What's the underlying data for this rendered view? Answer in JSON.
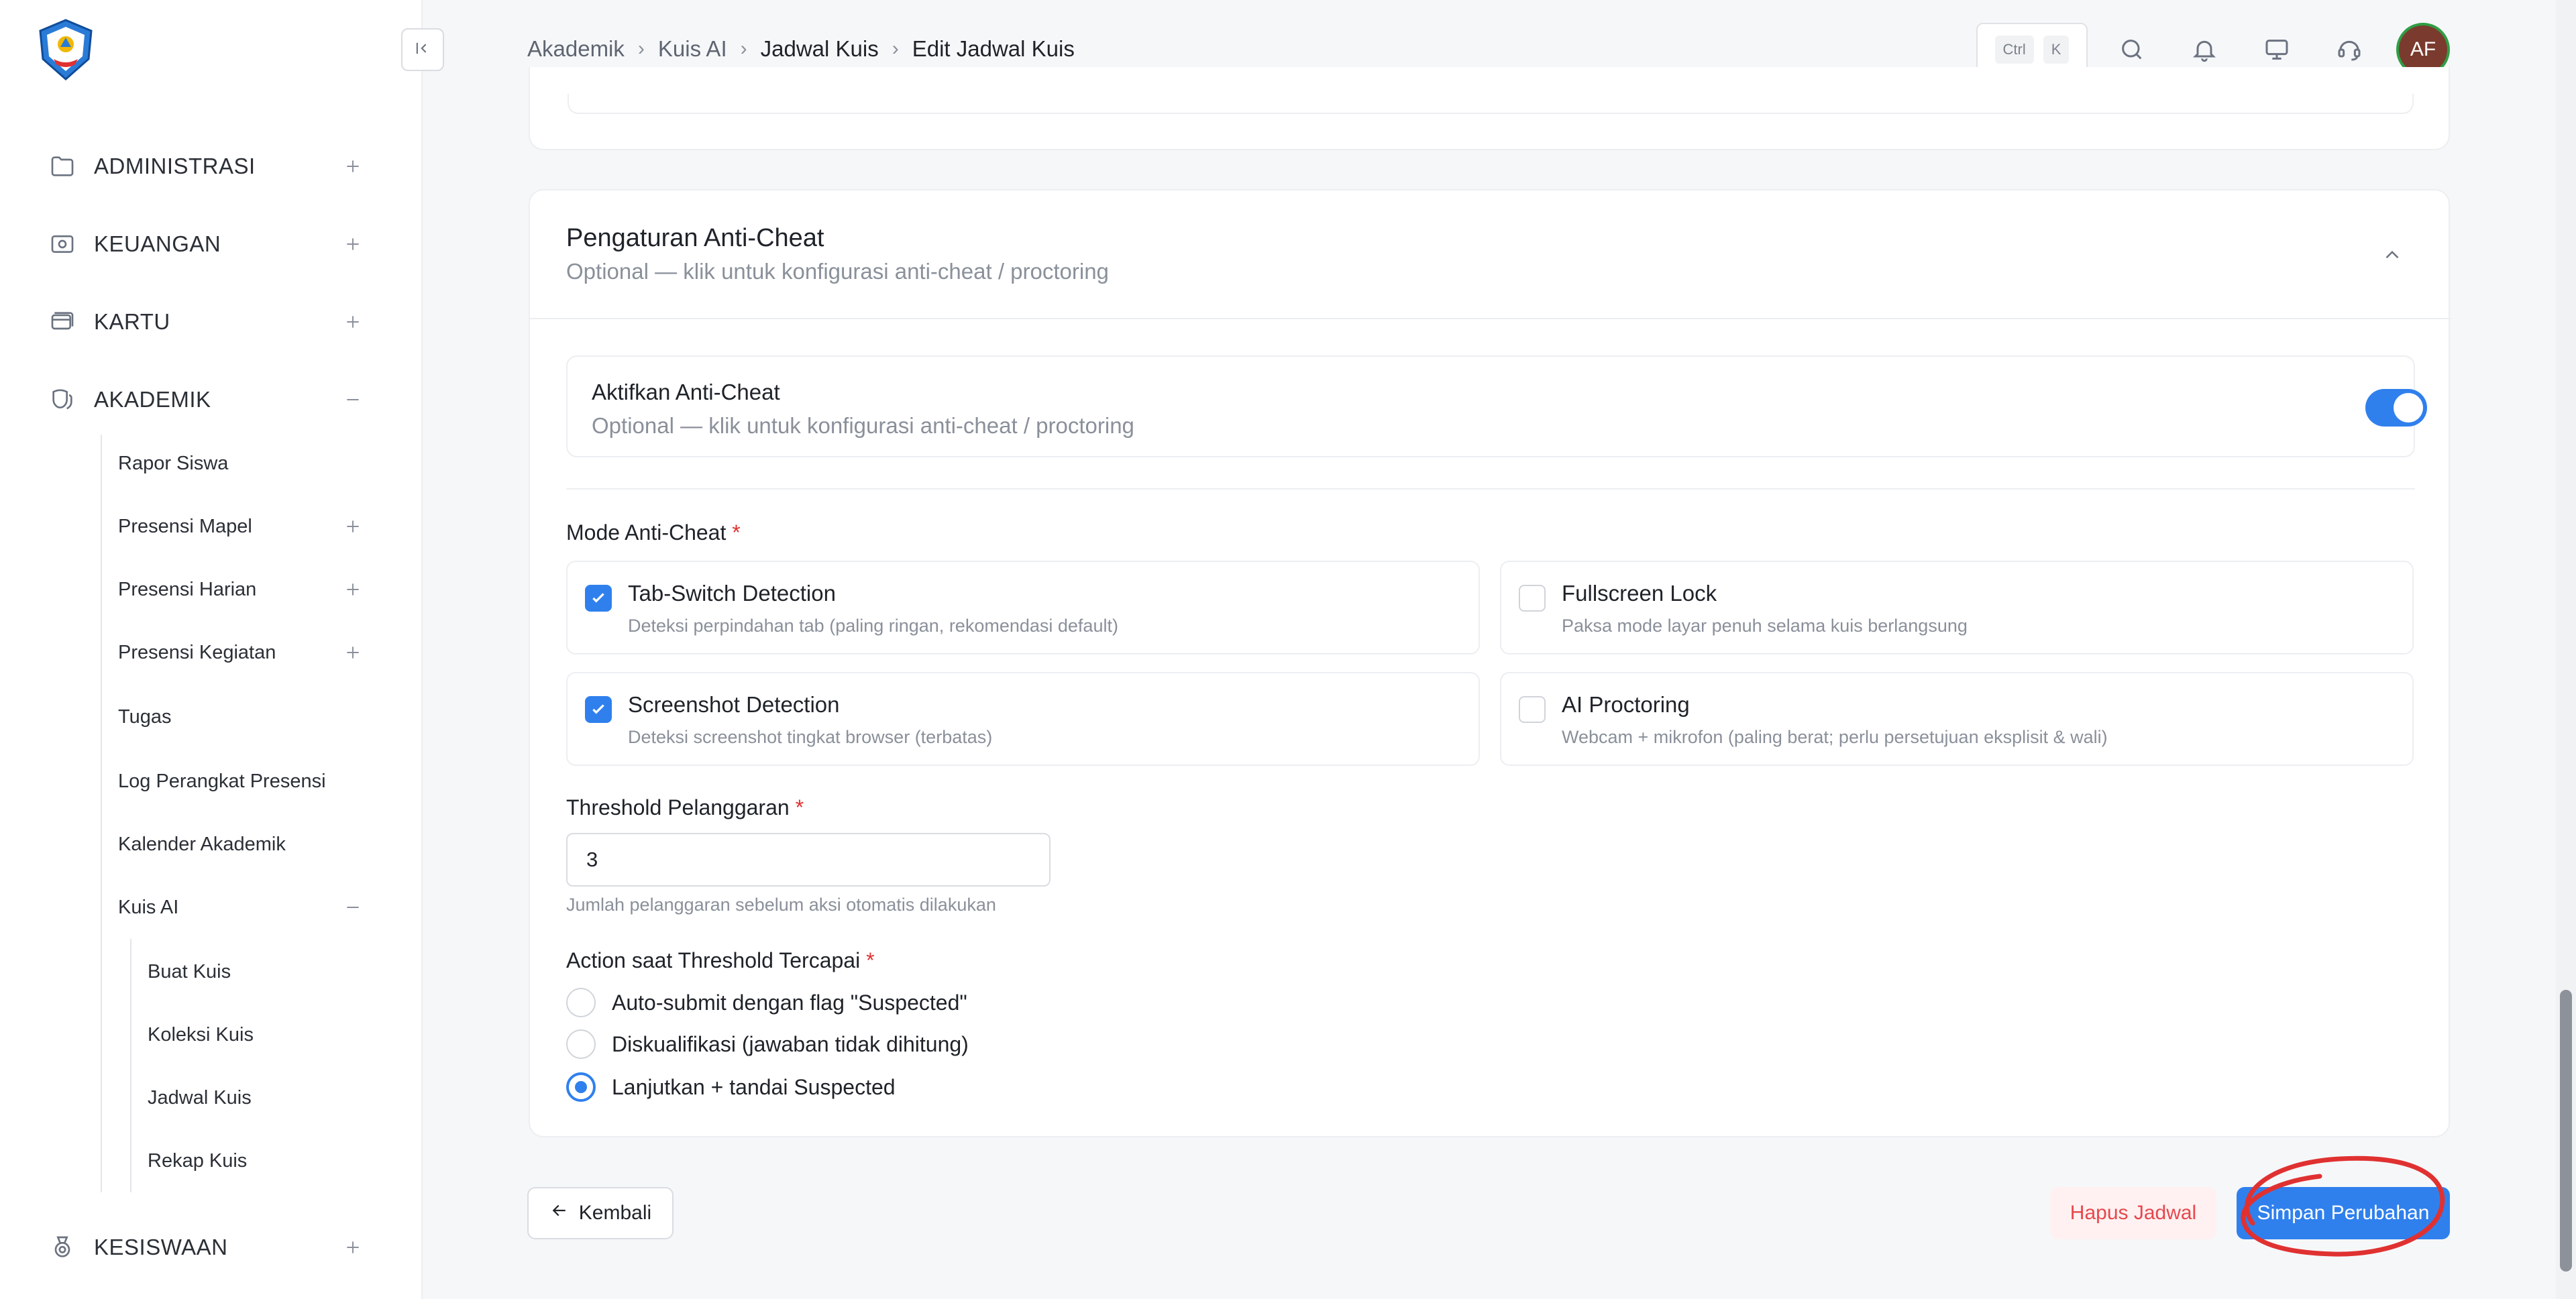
{
  "sidebar": {
    "sections": [
      {
        "label": "ADMINISTRASI",
        "sign": "+"
      },
      {
        "label": "KEUANGAN",
        "sign": "+"
      },
      {
        "label": "KARTU",
        "sign": "+"
      },
      {
        "label": "AKADEMIK",
        "sign": "−"
      }
    ],
    "akademik_items": [
      {
        "label": "Rapor Siswa",
        "sign": ""
      },
      {
        "label": "Presensi Mapel",
        "sign": "+"
      },
      {
        "label": "Presensi Harian",
        "sign": "+"
      },
      {
        "label": "Presensi Kegiatan",
        "sign": "+"
      },
      {
        "label": "Tugas",
        "sign": ""
      },
      {
        "label": "Log Perangkat Presensi",
        "sign": ""
      },
      {
        "label": "Kalender Akademik",
        "sign": ""
      },
      {
        "label": "Kuis AI",
        "sign": "−"
      }
    ],
    "kuis_items": [
      {
        "label": "Buat Kuis"
      },
      {
        "label": "Koleksi Kuis"
      },
      {
        "label": "Jadwal Kuis"
      },
      {
        "label": "Rekap Kuis"
      }
    ],
    "kesiswaan": {
      "label": "KESISWAAN",
      "sign": "+"
    }
  },
  "header": {
    "breadcrumb": [
      "Akademik",
      "Kuis AI",
      "Jadwal Kuis",
      "Edit Jadwal Kuis"
    ],
    "kbd_ctrl": "Ctrl",
    "kbd_k": "K",
    "avatar_initials": "AF"
  },
  "anticheat": {
    "title": "Pengaturan Anti-Cheat",
    "subtitle": "Optional — klik untuk konfigurasi anti-cheat / proctoring",
    "toggle_title": "Aktifkan Anti-Cheat",
    "toggle_subtitle": "Optional — klik untuk konfigurasi anti-cheat / proctoring",
    "enabled": true,
    "mode_label": "Mode Anti-Cheat",
    "modes": [
      {
        "title": "Tab-Switch Detection",
        "desc": "Deteksi perpindahan tab (paling ringan, rekomendasi default)",
        "checked": true
      },
      {
        "title": "Fullscreen Lock",
        "desc": "Paksa mode layar penuh selama kuis berlangsung",
        "checked": false
      },
      {
        "title": "Screenshot Detection",
        "desc": "Deteksi screenshot tingkat browser (terbatas)",
        "checked": true
      },
      {
        "title": "AI Proctoring",
        "desc": "Webcam + mikrofon (paling berat; perlu persetujuan eksplisit & wali)",
        "checked": false
      }
    ],
    "threshold_label": "Threshold Pelanggaran",
    "threshold_value": "3",
    "threshold_help": "Jumlah pelanggaran sebelum aksi otomatis dilakukan",
    "action_label": "Action saat Threshold Tercapai",
    "actions": [
      {
        "label": "Auto-submit dengan flag \"Suspected\"",
        "selected": false
      },
      {
        "label": "Diskualifikasi (jawaban tidak dihitung)",
        "selected": false
      },
      {
        "label": "Lanjutkan + tandai Suspected",
        "selected": true
      }
    ],
    "required_mark": "*"
  },
  "footer": {
    "back_label": "Kembali",
    "delete_label": "Hapus Jadwal",
    "save_label": "Simpan Perubahan"
  },
  "colors": {
    "accent": "#2f80ed",
    "danger": "#e5484d",
    "annotation": "#e03131"
  }
}
